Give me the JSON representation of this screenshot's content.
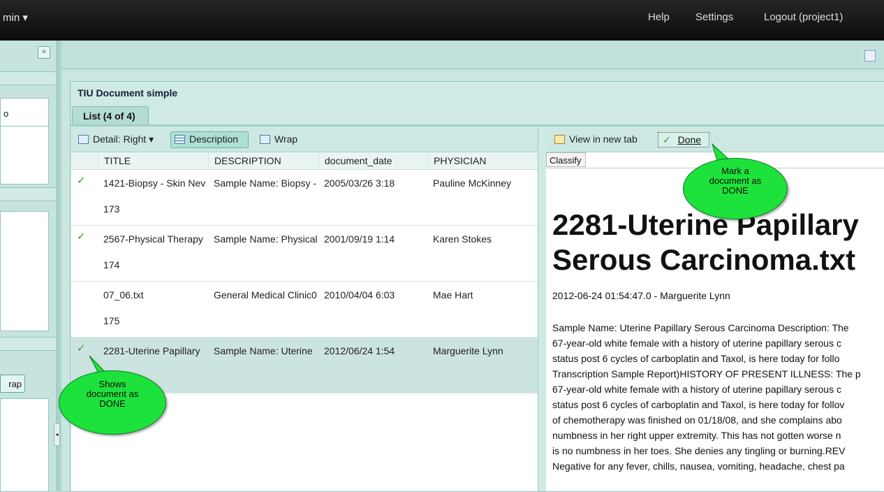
{
  "topbar": {
    "admin_menu": "min ▾",
    "help": "Help",
    "settings": "Settings",
    "logout": "Logout (project1)"
  },
  "left": {
    "collapse": "«",
    "fragment_label": "o",
    "button_fragment": "rap"
  },
  "panel": {
    "title": "TIU Document simple",
    "tab": "List (4 of 4)"
  },
  "list_toolbar": {
    "detail": "Detail: Right",
    "description": "Description",
    "wrap": "Wrap"
  },
  "columns": [
    "TITLE",
    "DESCRIPTION",
    "document_date",
    "PHYSICIAN"
  ],
  "rows": [
    {
      "done": true,
      "title": "1421-Biopsy - Skin Nev",
      "description": "Sample Name: Biopsy -",
      "date": "2005/03/26 3:18",
      "physician": "Pauline McKinney",
      "id": "173"
    },
    {
      "done": true,
      "title": "2567-Physical Therapy",
      "description": "Sample Name: Physical",
      "date": "2001/09/19 1:14",
      "physician": "Karen Stokes",
      "id": "174"
    },
    {
      "done": false,
      "title": "07_06.txt",
      "description": "General Medical Clinic0",
      "date": "2010/04/04 6:03",
      "physician": "Mae Hart",
      "id": "175"
    },
    {
      "done": true,
      "title": "2281-Uterine Papillary",
      "description": "Sample Name: Uterine",
      "date": "2012/06/24 1:54",
      "physician": "Marguerite Lynn",
      "id": ""
    }
  ],
  "detail": {
    "view_new_tab": "View in new tab",
    "done": "Done",
    "classify": "Classify",
    "title_line1": "2281-Uterine Papillary",
    "title_line2": "Serous Carcinoma.txt",
    "meta": "2012-06-24 01:54:47.0 - Marguerite Lynn",
    "body": [
      "Sample Name: Uterine Papillary Serous Carcinoma Description: The",
      "67-year-old white female with a history of uterine papillary serous c",
      "status post 6 cycles of carboplatin and Taxol, is here today for follo",
      "Transcription Sample Report)HISTORY OF PRESENT ILLNESS: The p",
      "67-year-old white female with a history of uterine papillary serous c",
      "status post 6 cycles of carboplatin and Taxol, is here today for follov",
      "of chemotherapy was finished on 01/18/08, and she complains abo",
      "numbness in her right upper extremity. This has not gotten worse n",
      "is no numbness in her toes. She denies any tingling or burning.REV",
      "Negative for any fever, chills, nausea, vomiting, headache, chest pa"
    ]
  },
  "callouts": {
    "mark_done": "Mark a document as DONE",
    "shows_done": "Shows document as DONE"
  },
  "colors": {
    "accent": "#1ee23c",
    "check": "#3e9a3a",
    "panel": "#cfe9e4"
  }
}
